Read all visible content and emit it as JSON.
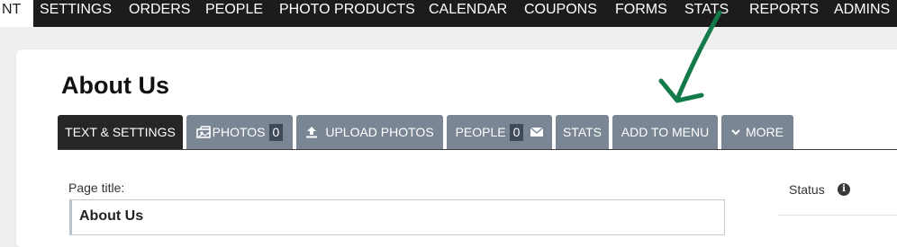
{
  "top_nav": {
    "items": [
      {
        "label": "NT",
        "active": true
      },
      {
        "label": "SETTINGS"
      },
      {
        "label": "ORDERS"
      },
      {
        "label": "PEOPLE"
      },
      {
        "label": "PHOTO PRODUCTS"
      },
      {
        "label": "CALENDAR"
      },
      {
        "label": "COUPONS"
      },
      {
        "label": "FORMS"
      },
      {
        "label": "STATS"
      },
      {
        "label": "REPORTS"
      },
      {
        "label": "ADMINS"
      }
    ]
  },
  "page": {
    "title": "About Us"
  },
  "tabs": {
    "text_settings": "TEXT & SETTINGS",
    "photos": "PHOTOS",
    "photos_count": "0",
    "upload_photos": "UPLOAD PHOTOS",
    "people": "PEOPLE",
    "people_count": "0",
    "stats": "STATS",
    "add_to_menu": "ADD TO MENU",
    "more": "MORE"
  },
  "form": {
    "page_title_label": "Page title:",
    "page_title_value": "About Us",
    "status_label": "Status",
    "info_glyph": "i"
  },
  "colors": {
    "nav_bg": "#1c1c1c",
    "tab_bg": "#7a8694",
    "tab_active_bg": "#262626",
    "annotation_arrow": "#137a4a"
  },
  "icons": {
    "photos_tab": "photos-icon",
    "upload_tab": "upload-icon",
    "people_tab": "envelope-icon",
    "more_tab": "chevron-down-icon",
    "status": "info-icon"
  }
}
